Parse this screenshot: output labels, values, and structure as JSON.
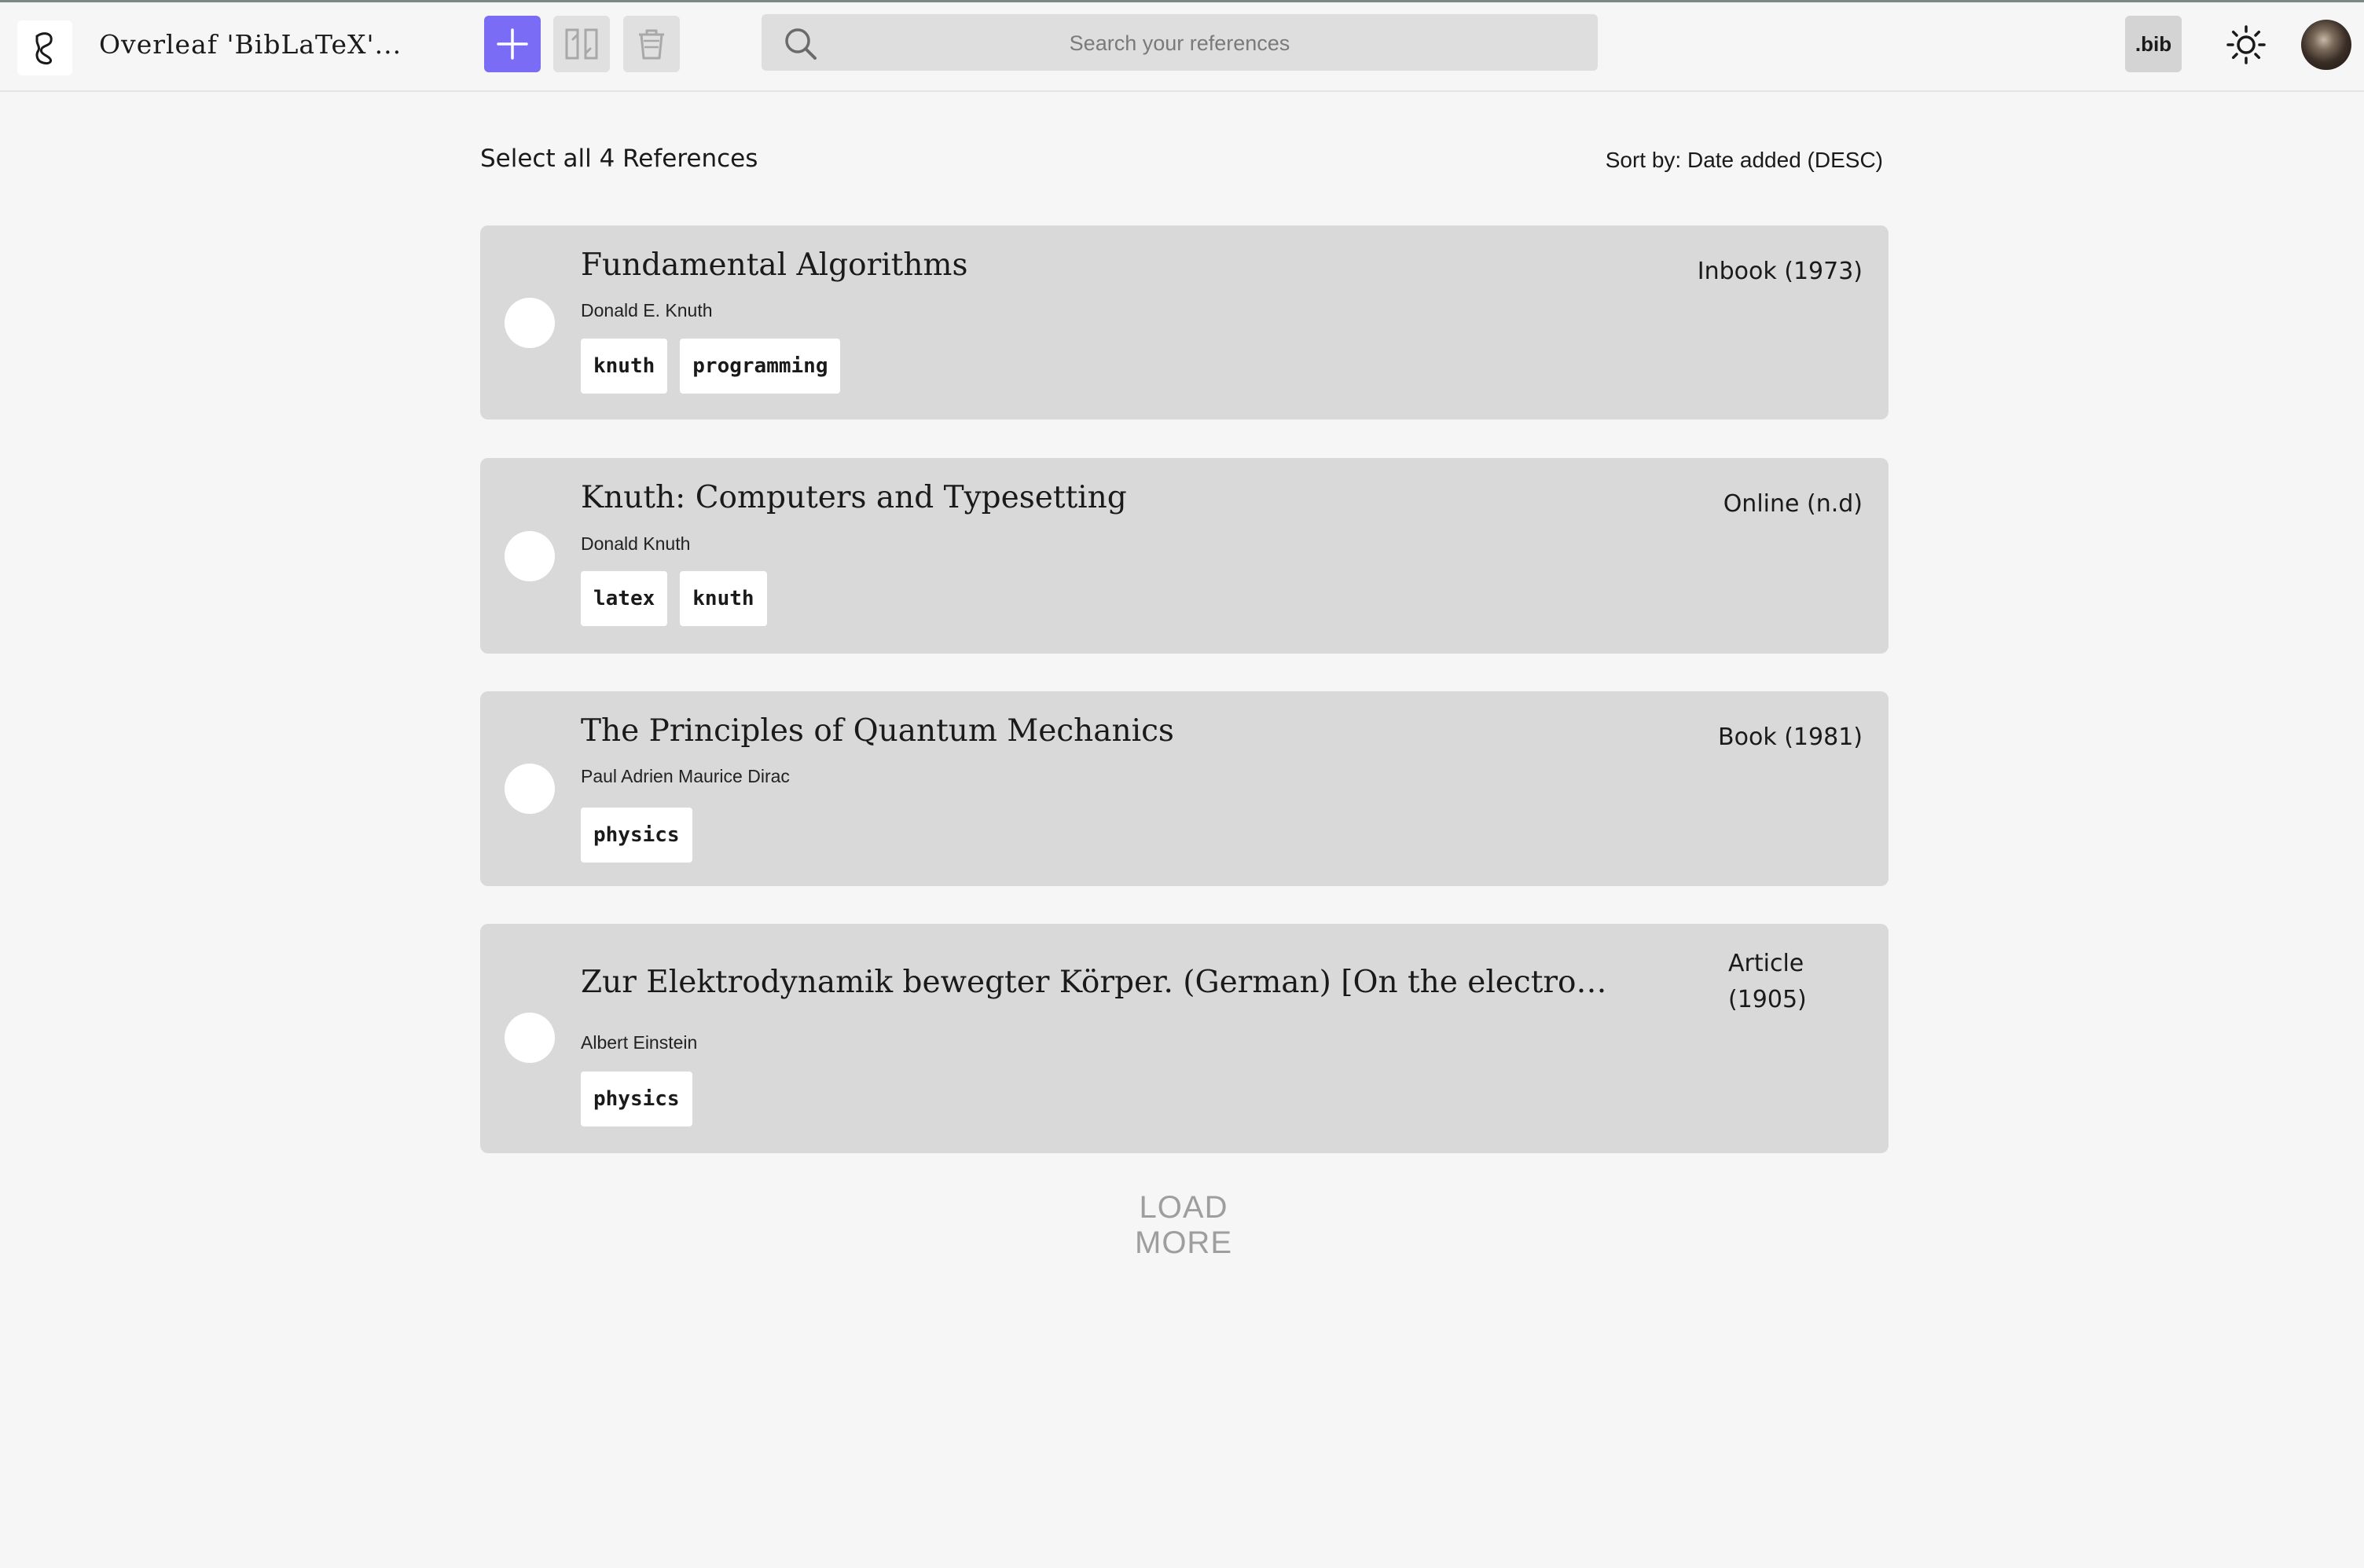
{
  "header": {
    "app_title": "Overleaf 'BibLaTeX'...",
    "search_placeholder": "Search your references",
    "bib_label": ".bib",
    "brand_color": "#7b6cf5"
  },
  "toolbar": {
    "icons": [
      "add-icon",
      "split-view-icon",
      "trash-icon",
      "search-icon",
      "sun-icon"
    ]
  },
  "list": {
    "select_all_label": "Select all 4 References",
    "sort_label": "Sort by: Date added (DESC)",
    "load_more_label": "LOAD MORE"
  },
  "references": [
    {
      "title": "Fundamental Algorithms",
      "author": "Donald E. Knuth",
      "type": "Inbook (1973)",
      "tags": [
        "knuth",
        "programming"
      ]
    },
    {
      "title": "Knuth: Computers and Typesetting",
      "author": "Donald Knuth",
      "type": "Online (n.d)",
      "tags": [
        "latex",
        "knuth"
      ]
    },
    {
      "title": "The Principles of Quantum Mechanics",
      "author": "Paul Adrien Maurice Dirac",
      "type": "Book (1981)",
      "tags": [
        "physics"
      ]
    },
    {
      "title": "Zur Elektrodynamik bewegter Körper. (German) [On the electrodynamics of moving bodies]",
      "author": "Albert Einstein",
      "type_line1": "Article",
      "type_line2": "(1905)",
      "tags": [
        "physics"
      ]
    }
  ]
}
